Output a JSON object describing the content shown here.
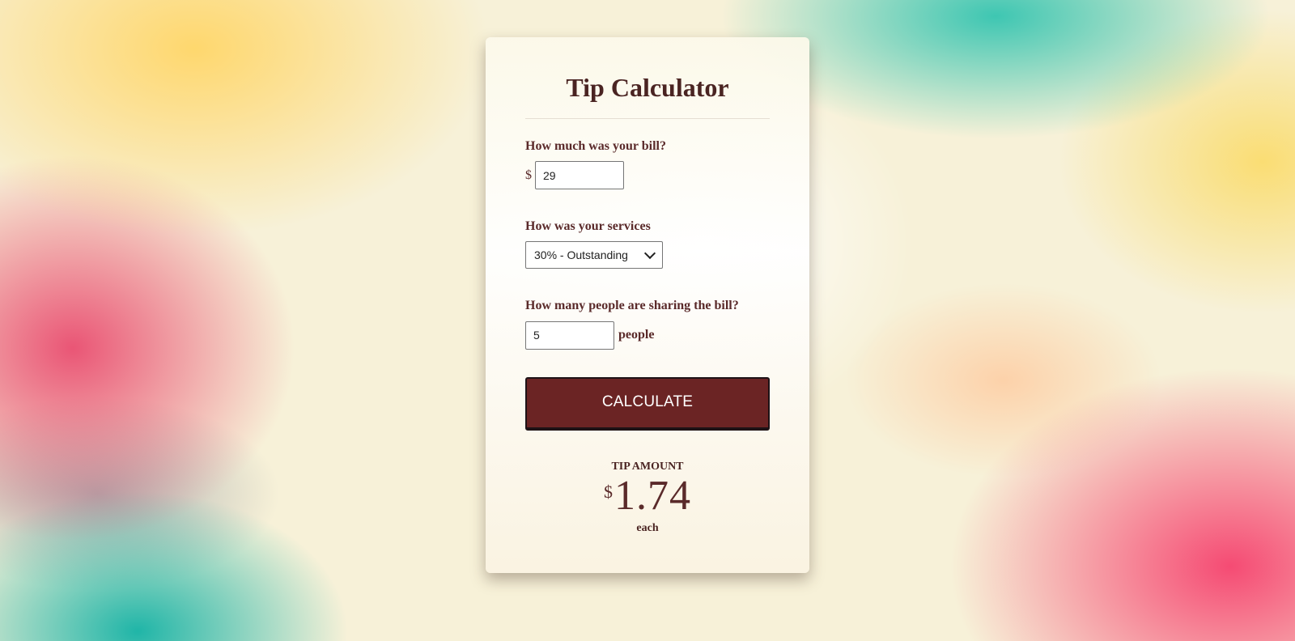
{
  "calculator": {
    "title": "Tip Calculator",
    "bill": {
      "label": "How much was your bill?",
      "currency": "$",
      "value": "29"
    },
    "service": {
      "label": "How was your services",
      "selected": "30% - Outstanding",
      "icon": "chevron-down-icon"
    },
    "people": {
      "label": "How many people are sharing the bill?",
      "value": "5",
      "unit": "people"
    },
    "calculate_label": "CALCULATE",
    "result": {
      "label": "TIP AMOUNT",
      "currency": "$",
      "amount": "1.74",
      "suffix": "each"
    }
  },
  "colors": {
    "primary_text": "#5a2a2a",
    "button_bg": "#6b2424",
    "button_text": "#ffffff"
  }
}
